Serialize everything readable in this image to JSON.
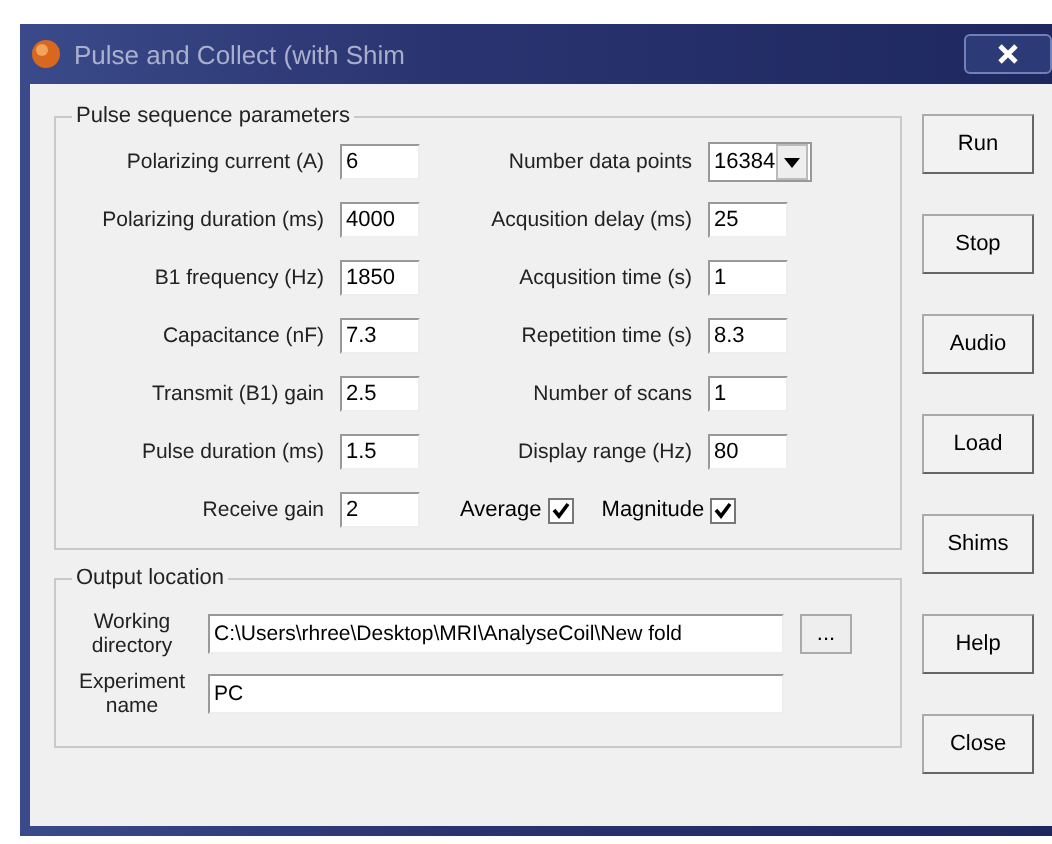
{
  "window": {
    "title": "Pulse and Collect (with Shim"
  },
  "pulse_group": {
    "title": "Pulse sequence parameters",
    "left_fields": [
      {
        "label": "Polarizing current (A)",
        "value": "6"
      },
      {
        "label": "Polarizing duration (ms)",
        "value": "4000"
      },
      {
        "label": "B1 frequency (Hz)",
        "value": "1850"
      },
      {
        "label": "Capacitance (nF)",
        "value": "7.3"
      },
      {
        "label": "Transmit (B1) gain",
        "value": "2.5"
      },
      {
        "label": "Pulse duration (ms)",
        "value": "1.5"
      },
      {
        "label": "Receive gain",
        "value": "2"
      }
    ],
    "right_fields": [
      {
        "kind": "dropdown",
        "label": "Number data points",
        "value": "16384"
      },
      {
        "kind": "text",
        "label": "Acqusition delay (ms)",
        "value": "25"
      },
      {
        "kind": "text",
        "label": "Acqusition time (s)",
        "value": "1"
      },
      {
        "kind": "text",
        "label": "Repetition time (s)",
        "value": "8.3"
      },
      {
        "kind": "text",
        "label": "Number of scans",
        "value": "1"
      },
      {
        "kind": "text",
        "label": "Display range (Hz)",
        "value": "80"
      }
    ],
    "checkboxes": [
      {
        "label": "Average",
        "checked": true
      },
      {
        "label": "Magnitude",
        "checked": true
      }
    ]
  },
  "output_group": {
    "title": "Output location",
    "working_directory": {
      "label_lines": [
        "Working",
        "directory"
      ],
      "value": "C:\\Users\\rhree\\Desktop\\MRI\\AnalyseCoil\\New fold",
      "browse": "..."
    },
    "experiment_name": {
      "label_lines": [
        "Experiment",
        "name"
      ],
      "value": "PC"
    }
  },
  "buttons": [
    "Run",
    "Stop",
    "Audio",
    "Load",
    "Shims",
    "Help",
    "Close"
  ]
}
